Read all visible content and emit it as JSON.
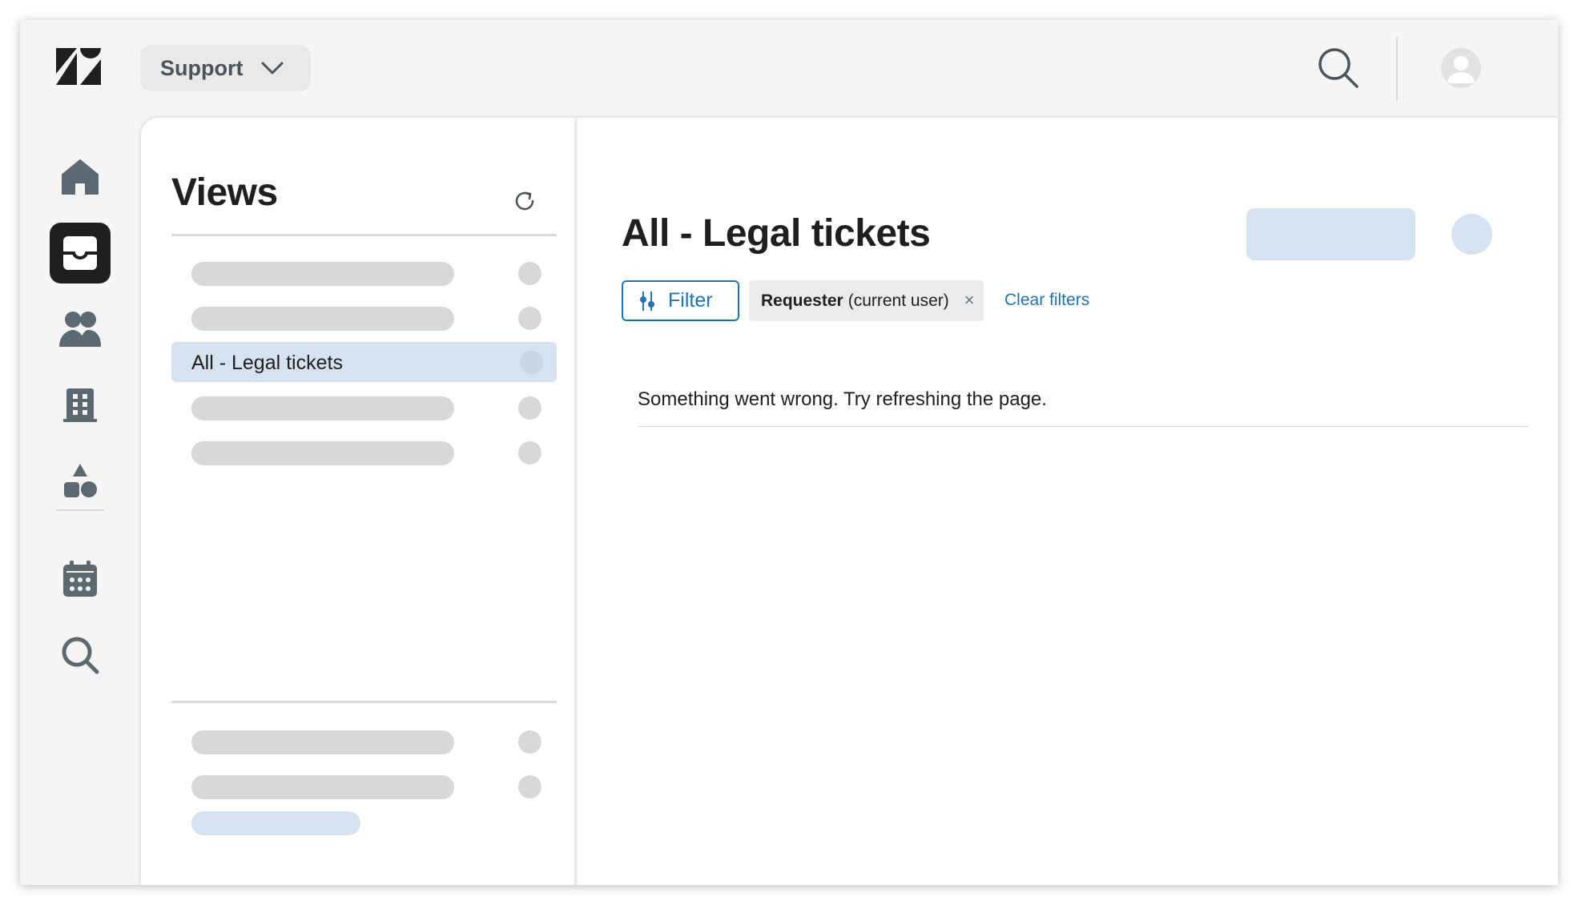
{
  "header": {
    "product_label": "Support",
    "icons": [
      "zendesk-logo",
      "chevron-down-icon",
      "search-icon",
      "avatar-icon"
    ]
  },
  "nav": {
    "items": [
      {
        "name": "home",
        "icon": "home-icon"
      },
      {
        "name": "views",
        "icon": "inbox-icon",
        "active": true
      },
      {
        "name": "customers",
        "icon": "users-icon"
      },
      {
        "name": "organizations",
        "icon": "building-icon"
      },
      {
        "name": "admin",
        "icon": "shapes-icon"
      },
      {
        "name": "calendar",
        "icon": "calendar-icon"
      },
      {
        "name": "search",
        "icon": "search-icon"
      }
    ]
  },
  "views_panel": {
    "title": "Views",
    "active_view": "All - Legal tickets",
    "refresh_icon": "refresh-icon"
  },
  "content": {
    "title": "All - Legal tickets",
    "filter_label": "Filter",
    "chip": {
      "field": "Requester",
      "value": "(current user)",
      "close": "×"
    },
    "clear_filters": "Clear filters",
    "error_message": "Something went wrong. Try refreshing the page."
  },
  "colors": {
    "accent": "#1f73b7",
    "active_view_bg": "#d6e2ef",
    "skeleton_gray": "#d8d8d8",
    "skeleton_blue": "#d5e2ef",
    "nav_active": "#1f1f1f",
    "icon_gray": "#68737d"
  }
}
